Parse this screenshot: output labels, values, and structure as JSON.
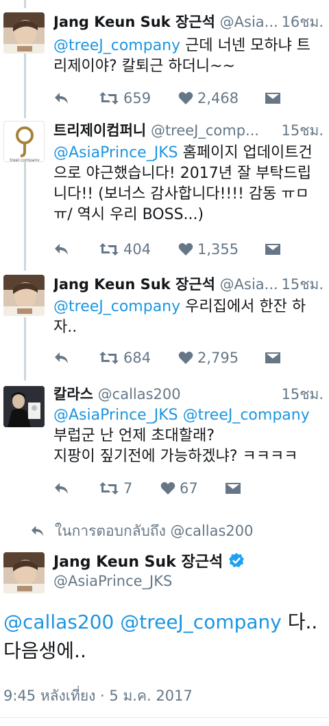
{
  "tweets": [
    {
      "name": "Jang Keun Suk 장근석",
      "handle": "@Asia...",
      "time": "16ชม.",
      "body_mention": "@treeJ_company",
      "body_text": " 근데 너넨 모하냐 트리제이야? 칼퇴근 하더니~~",
      "retweets": "659",
      "likes": "2,468"
    },
    {
      "name": "트리제이컴퍼니",
      "handle": "@treeJ_comp...",
      "time": "15ชม.",
      "body_mention": "@AsiaPrince_JKS",
      "body_text": " 홈페이지 업데이트건으로 야근했습니다! 2017년 잘 부탁드립니다!! (보너스 감사합니다!!!! 감동 ㅠㅁ ㅠ/ 역시 우리 BOSS...)",
      "retweets": "404",
      "likes": "1,355"
    },
    {
      "name": "Jang Keun Suk 장근석",
      "handle": "@Asia...",
      "time": "15ชม.",
      "body_mention": "@treeJ_company",
      "body_text": " 우리집에서 한잔 하자..",
      "retweets": "684",
      "likes": "2,795"
    },
    {
      "name": "칼라스",
      "handle": "@callas200",
      "time": "15ชม.",
      "body_mention": "@AsiaPrince_JKS @treeJ_company",
      "body_line2": "부럽군 난 언제 초대할래?",
      "body_line3": "지팡이 짚기전에 가능하겠냐? ㅋㅋㅋㅋ",
      "retweets": "7",
      "likes": "67"
    }
  ],
  "reply_context": "ในการตอบกลับถึง @callas200",
  "focus": {
    "name": "Jang Keun Suk 장근석",
    "handle": "@AsiaPrince_JKS",
    "mention1": "@callas200",
    "mention2": "@treeJ_company",
    "text": " 다..다음생에..",
    "timestamp": "9:45 หลังเที่ยง · 5 ม.ค. 2017"
  },
  "icons": {
    "reply": "reply-arrow-icon",
    "retweet": "retweet-icon",
    "like": "heart-icon",
    "dm": "envelope-icon",
    "verified": "verified-badge-icon"
  },
  "colors": {
    "link": "#1b95e0",
    "muted": "#657786",
    "thread_line": "#ccd6dd",
    "verified": "#1da1f2"
  }
}
